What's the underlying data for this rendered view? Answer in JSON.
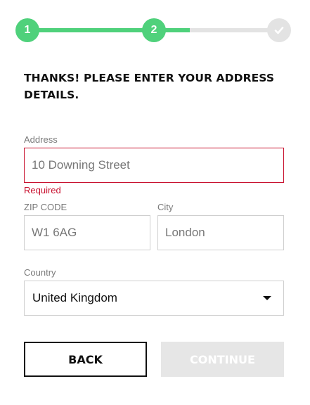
{
  "stepper": {
    "steps": [
      {
        "label": "1",
        "state": "complete"
      },
      {
        "label": "2",
        "state": "current"
      },
      {
        "label": "",
        "icon": "check-icon",
        "state": "upcoming"
      }
    ],
    "colors": {
      "active": "#4fd17b",
      "inactive": "#e3e3e3"
    }
  },
  "heading": "THANKS! PLEASE ENTER YOUR ADDRESS DETAILS.",
  "form": {
    "address": {
      "label": "Address",
      "value": "10 Downing Street",
      "error": "Required"
    },
    "zip": {
      "label": "ZIP CODE",
      "value": "W1 6AG"
    },
    "city": {
      "label": "City",
      "value": "London"
    },
    "country": {
      "label": "Country",
      "selected": "United Kingdom"
    }
  },
  "buttons": {
    "back": "BACK",
    "continue": "CONTINUE"
  },
  "colors": {
    "error": "#c8102e",
    "text": "#111111",
    "disabled_button": "#e6e6e6"
  }
}
